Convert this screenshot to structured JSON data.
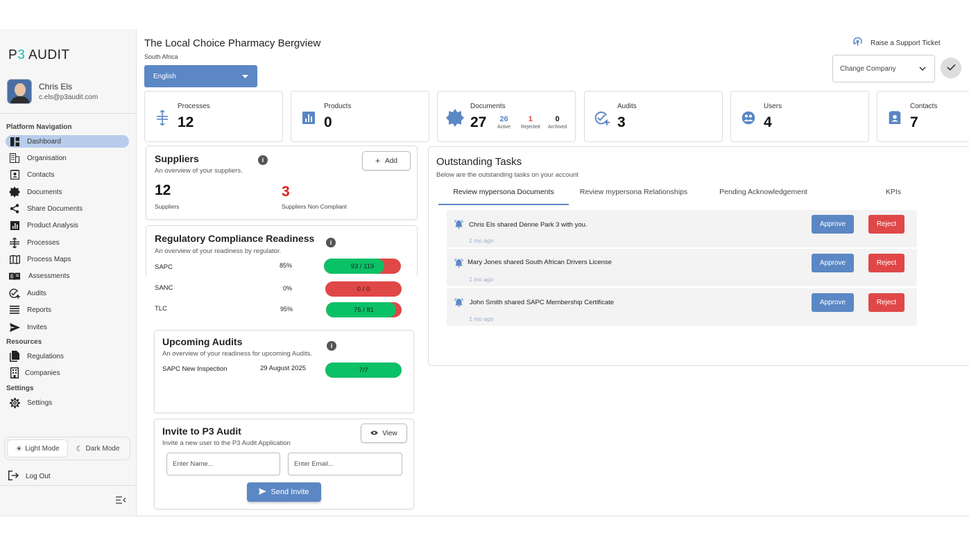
{
  "app": {
    "logo_prefix": "P",
    "logo_number": "3",
    "logo_suffix": " AUDIT"
  },
  "user": {
    "name": "Chris Els",
    "email": "c.els@p3audit.com"
  },
  "sidebar": {
    "platform_label": "Platform Navigation",
    "items": [
      {
        "label": "Dashboard",
        "icon": "dashboard-icon",
        "active": true
      },
      {
        "label": "Organisation",
        "icon": "organisation-icon"
      },
      {
        "label": "Contacts",
        "icon": "contacts-icon"
      },
      {
        "label": "Documents",
        "icon": "documents-icon"
      },
      {
        "label": "Share Documents",
        "icon": "share-icon"
      },
      {
        "label": "Product Analysis",
        "icon": "product-analysis-icon"
      },
      {
        "label": "Processes",
        "icon": "processes-icon"
      },
      {
        "label": "Process Maps",
        "icon": "map-icon"
      },
      {
        "label": "Assessments",
        "icon": "assessments-icon"
      },
      {
        "label": "Audits",
        "icon": "audits-icon"
      },
      {
        "label": "Reports",
        "icon": "reports-icon"
      },
      {
        "label": "Invites",
        "icon": "send-icon"
      }
    ],
    "resources_label": "Resources",
    "resources": [
      {
        "label": "Regulations",
        "icon": "regulations-icon"
      },
      {
        "label": "Companies",
        "icon": "companies-icon"
      }
    ],
    "settings_label": "Settings",
    "settings": [
      {
        "label": "Settings",
        "icon": "gear-icon"
      }
    ],
    "light_mode": "Light Mode",
    "dark_mode": "Dark Mode",
    "logout": "Log Out"
  },
  "header": {
    "company": "The Local Choice Pharmacy Bergview",
    "country": "South Africa",
    "language": "English",
    "support": "Raise a Support Ticket",
    "change_company": "Change Company"
  },
  "stats": {
    "processes": {
      "label": "Processes",
      "value": "12"
    },
    "products": {
      "label": "Products",
      "value": "0"
    },
    "documents": {
      "label": "Documents",
      "value": "27",
      "active": "26",
      "active_label": "Active",
      "rejected": "1",
      "rejected_label": "Rejected",
      "archived": "0",
      "archived_label": "Archived"
    },
    "audits": {
      "label": "Audits",
      "value": "3"
    },
    "users": {
      "label": "Users",
      "value": "4"
    },
    "contacts": {
      "label": "Contacts",
      "value": "7"
    }
  },
  "suppliers": {
    "title": "Suppliers",
    "subtitle": "An overview of your suppliers.",
    "add": "Add",
    "count": "12",
    "count_label": "Suppliers",
    "non_compliant": "3",
    "non_compliant_label": "Suppliers Non Compliant"
  },
  "compliance": {
    "title": "Regulatory Compliance Readiness",
    "subtitle": "An overview of your readiness by regulator.",
    "rows": [
      {
        "name": "SAPC",
        "percent": "85%",
        "ratio": "93 / 119",
        "fill": 0.78
      },
      {
        "name": "SANC",
        "percent": "0%",
        "ratio": "0 / 0",
        "fill": 0
      },
      {
        "name": "TLC",
        "percent": "95%",
        "ratio": "75 / 81",
        "fill": 0.93
      }
    ]
  },
  "upcoming": {
    "title": "Upcoming Audits",
    "subtitle": "An overview of your readiness for upcoming Audits.",
    "rows": [
      {
        "name": "SAPC New Inspection",
        "date": "29 August 2025",
        "ratio": "7/7",
        "fill": 1
      }
    ]
  },
  "invite": {
    "title": "Invite to P3 Audit",
    "subtitle": "Invite a new user to the P3 Audit Application",
    "view": "View",
    "name_placeholder": "Enter Name...",
    "email_placeholder": "Enter Email...",
    "send": "Send Invite"
  },
  "tasks": {
    "title": "Outstanding Tasks",
    "subtitle": "Below are the outstanding tasks on your account",
    "tabs": [
      "Review mypersona Documents",
      "Review mypersona Relationships",
      "Pending Acknowledgement",
      "KPIs"
    ],
    "items": [
      {
        "message": "Chris Els shared Denne Park 3 with you.",
        "ago": "1 mo ago"
      },
      {
        "message": "Mary Jones shared South African Drivers License",
        "ago": "1 mo ago"
      },
      {
        "message": "John Smith shared SAPC Membership Certificate",
        "ago": "1 mo ago"
      }
    ],
    "approve": "Approve",
    "reject": "Reject"
  },
  "colors": {
    "accent": "#5b87c4",
    "green": "#0bc167",
    "red": "#e04848",
    "teal": "#1fb5a8"
  }
}
